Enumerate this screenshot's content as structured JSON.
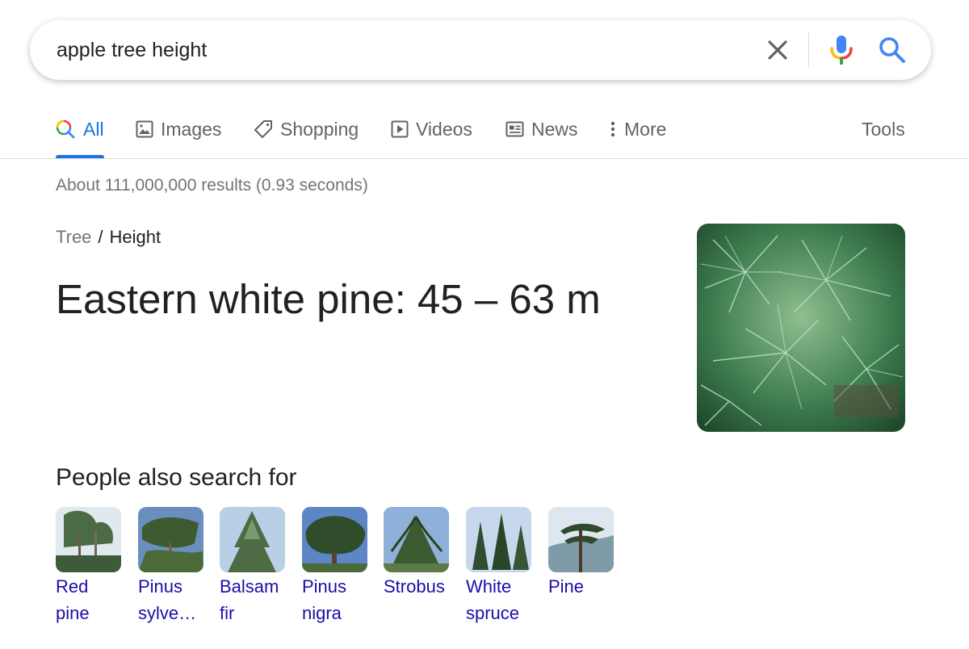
{
  "search": {
    "query": "apple tree height",
    "icons": {
      "clear": "close-icon",
      "mic": "microphone-icon",
      "search": "search-icon"
    }
  },
  "tabs": [
    {
      "label": "All",
      "icon": "search-multicolor-icon",
      "active": true
    },
    {
      "label": "Images",
      "icon": "image-icon",
      "active": false
    },
    {
      "label": "Shopping",
      "icon": "tag-icon",
      "active": false
    },
    {
      "label": "Videos",
      "icon": "play-icon",
      "active": false
    },
    {
      "label": "News",
      "icon": "newspaper-icon",
      "active": false
    },
    {
      "label": "More",
      "icon": "more-vert-icon",
      "active": false
    }
  ],
  "tools_label": "Tools",
  "result_stats": "About 111,000,000 results (0.93 seconds)",
  "answer": {
    "breadcrumb": [
      "Tree",
      "Height"
    ],
    "breadcrumb_separator": "/",
    "text": "Eastern white pine: 45 – 63 m"
  },
  "people_also_search": {
    "heading": "People also search for",
    "items": [
      {
        "line1": "Red",
        "line2": "pine"
      },
      {
        "line1": "Pinus",
        "line2": "sylve…"
      },
      {
        "line1": "Balsam",
        "line2": "fir"
      },
      {
        "line1": "Pinus",
        "line2": "nigra"
      },
      {
        "line1": "Strobus",
        "line2": ""
      },
      {
        "line1": "White",
        "line2": "spruce"
      },
      {
        "line1": "Pine",
        "line2": ""
      }
    ]
  },
  "colors": {
    "accent_blue": "#1a73e8",
    "link": "#1a0dab",
    "text": "#202124",
    "muted": "#70757a"
  }
}
